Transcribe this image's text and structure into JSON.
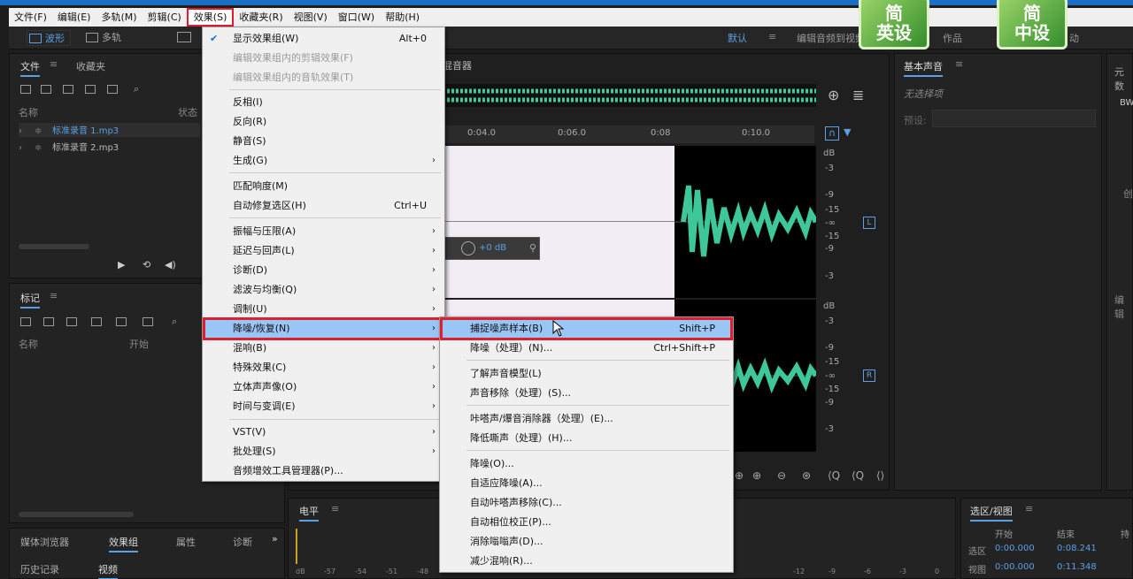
{
  "menubar": {
    "items": [
      "文件(F)",
      "编辑(E)",
      "多轨(M)",
      "剪辑(C)",
      "效果(S)",
      "收藏夹(R)",
      "视图(V)",
      "窗口(W)",
      "帮助(H)"
    ]
  },
  "toolbar": {
    "waveform": "波形",
    "multitrack": "多轨",
    "workspace": "默认",
    "edit_video": "编辑音频到视频",
    "works": "作品",
    "x": "X",
    "move": "动"
  },
  "badges": [
    {
      "top": "简",
      "bottom": "英设"
    },
    {
      "top": "简",
      "bottom": "中设"
    }
  ],
  "files_panel": {
    "tabs": [
      "文件",
      "收藏夹"
    ],
    "col_name": "名称",
    "col_status": "状态",
    "items": [
      "标准录音 1.mp3",
      "标准录音 2.mp3"
    ]
  },
  "markers_panel": {
    "title": "标记",
    "col_name": "名称",
    "col_start": "开始"
  },
  "bottom_tabs": {
    "row1": [
      "媒体浏览器",
      "效果组",
      "属性",
      "诊断"
    ],
    "row2": [
      "历史记录",
      "视频"
    ]
  },
  "editor": {
    "title": "混音器",
    "ruler": [
      "0:04.0",
      "0:06.0",
      "0:08",
      "0:10.0"
    ],
    "db_top": [
      "dB",
      "-3",
      "-9",
      "-15",
      "-∞",
      "-15",
      "-9",
      "-3"
    ],
    "db_bot": [
      "dB",
      "-3",
      "-9",
      "-15",
      "-∞",
      "-15",
      "-9",
      "-3"
    ],
    "ch_l": "L",
    "ch_r": "R",
    "hud_db": "+0 dB"
  },
  "basic_sound": {
    "title": "基本声音",
    "no_selection": "无选择项",
    "preset": "预设:"
  },
  "meta_panel": {
    "title": "元数",
    "bw": "BW",
    "side1": "创",
    "side2": "编辑"
  },
  "levels": {
    "title": "电平",
    "scale": [
      "dB",
      "-57",
      "-54",
      "-51",
      "-48",
      "-12",
      "-9",
      "-6",
      "-3",
      "0"
    ]
  },
  "selview": {
    "title": "选区/视图",
    "col_start": "开始",
    "col_end": "结束",
    "col_dur": "持",
    "sel_label": "选区",
    "view_label": "视图",
    "sel_start": "0:00.000",
    "sel_end": "0:08.241",
    "view_start": "0:00.000",
    "view_end": "0:11.348"
  },
  "effects_menu": {
    "items": [
      {
        "label": "显示效果组(W)",
        "shortcut": "Alt+0",
        "checked": true
      },
      {
        "label": "编辑效果组内的剪辑效果(F)",
        "disabled": true
      },
      {
        "label": "编辑效果组内的音轨效果(T)",
        "disabled": true
      },
      {
        "label": "反相(I)"
      },
      {
        "label": "反向(R)"
      },
      {
        "label": "静音(S)"
      },
      {
        "label": "生成(G)",
        "submenu": true
      },
      {
        "label": "匹配响度(M)"
      },
      {
        "label": "自动修复选区(H)",
        "shortcut": "Ctrl+U"
      },
      {
        "label": "振幅与压限(A)",
        "submenu": true
      },
      {
        "label": "延迟与回声(L)",
        "submenu": true
      },
      {
        "label": "诊断(D)",
        "submenu": true
      },
      {
        "label": "滤波与均衡(Q)",
        "submenu": true
      },
      {
        "label": "调制(U)",
        "submenu": true
      },
      {
        "label": "降噪/恢复(N)",
        "submenu": true,
        "highlighted": true
      },
      {
        "label": "混响(B)",
        "submenu": true
      },
      {
        "label": "特殊效果(C)",
        "submenu": true
      },
      {
        "label": "立体声声像(O)",
        "submenu": true
      },
      {
        "label": "时间与变调(E)",
        "submenu": true
      },
      {
        "label": "VST(V)",
        "submenu": true
      },
      {
        "label": "批处理(S)",
        "submenu": true
      },
      {
        "label": "音频增效工具管理器(P)..."
      }
    ]
  },
  "noise_menu": {
    "items": [
      {
        "label": "捕捉噪声样本(B)",
        "shortcut": "Shift+P",
        "highlighted": true
      },
      {
        "label": "降噪（处理）(N)...",
        "shortcut": "Ctrl+Shift+P"
      },
      {
        "label": "了解声音模型(L)"
      },
      {
        "label": "声音移除（处理）(S)..."
      },
      {
        "label": "咔嗒声/爆音消除器（处理）(E)..."
      },
      {
        "label": "降低嘶声（处理）(H)..."
      },
      {
        "label": "降噪(O)..."
      },
      {
        "label": "自适应降噪(A)..."
      },
      {
        "label": "自动咔嗒声移除(C)..."
      },
      {
        "label": "自动相位校正(P)..."
      },
      {
        "label": "消除嗡嗡声(D)..."
      },
      {
        "label": "减少混响(R)..."
      }
    ]
  },
  "colors": {
    "accent": "#5aa0e6",
    "highlight_border": "#e01e2e",
    "waveform": "#3ec89a"
  }
}
